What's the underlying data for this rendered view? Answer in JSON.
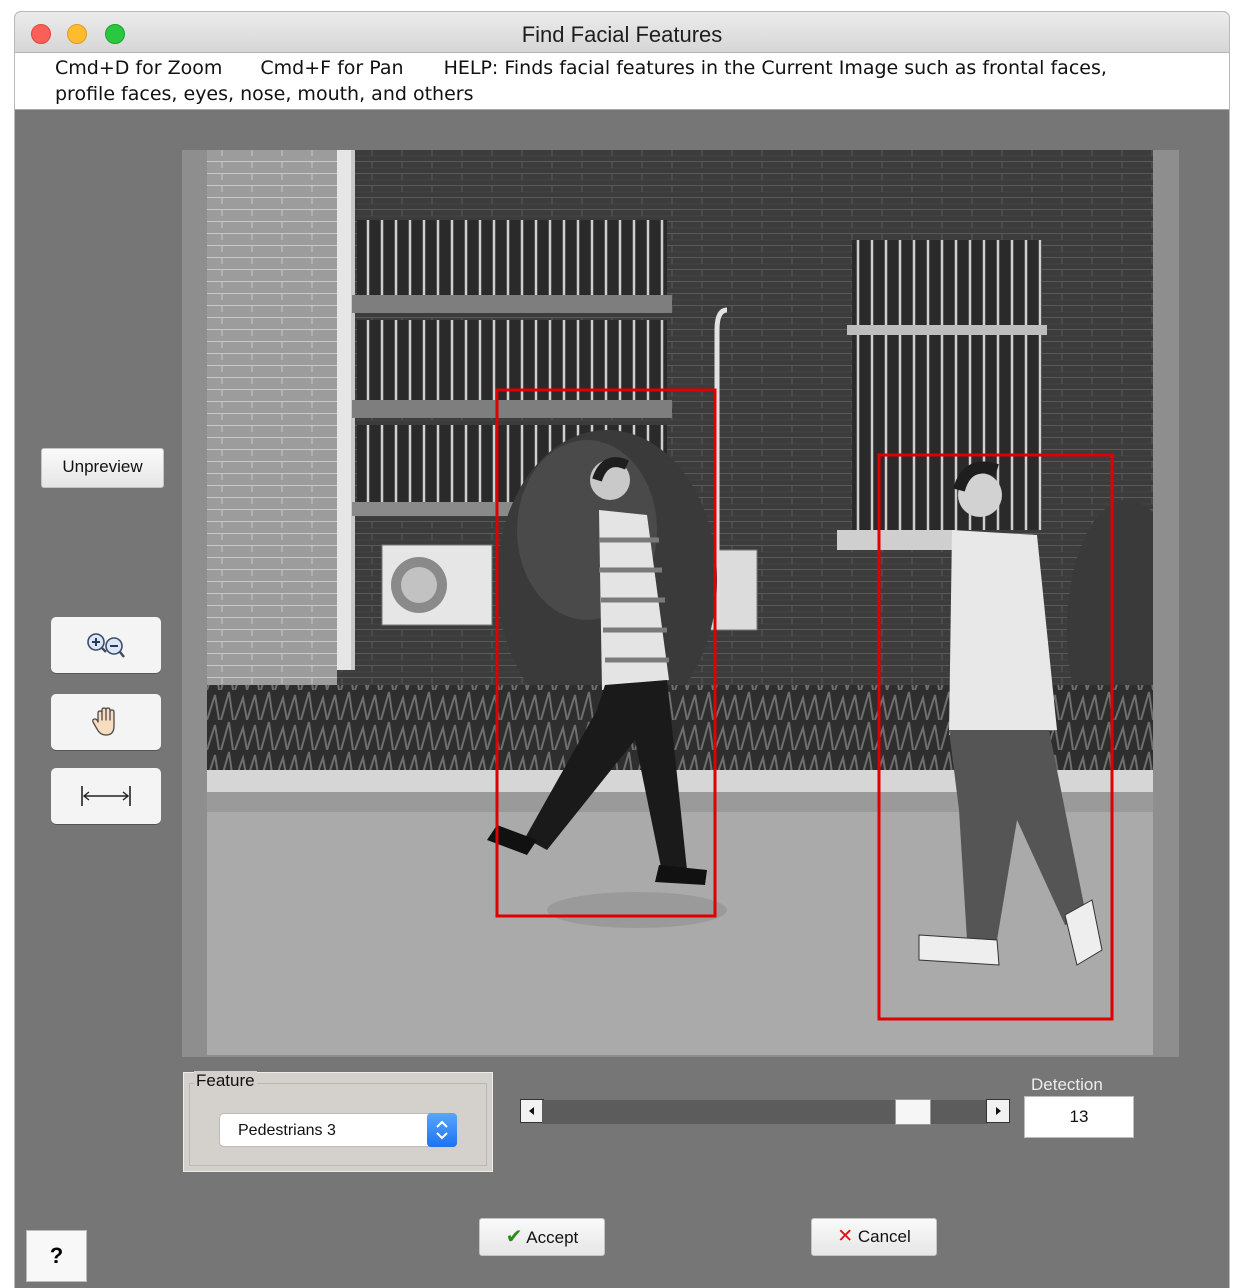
{
  "window": {
    "title": "Find Facial Features"
  },
  "help_text": {
    "zoom_shortcut": "Cmd+D for Zoom",
    "pan_shortcut": "Cmd+F for Pan",
    "help_line1": "HELP:  Finds facial features in the Current Image such as frontal faces,",
    "help_line2": "profile faces, eyes, nose, mouth, and others"
  },
  "sidebar": {
    "unpreview_label": "Unpreview",
    "tools": [
      {
        "icon": "zoom-in-out-icon"
      },
      {
        "icon": "hand-pan-icon"
      },
      {
        "icon": "fit-width-icon"
      }
    ]
  },
  "image": {
    "detections": 2
  },
  "feature": {
    "legend": "Feature",
    "selected": "Pedestrians 3"
  },
  "detection": {
    "label": "Detection",
    "value": "13",
    "slider_fraction": 0.86
  },
  "footer": {
    "accept_label": "Accept",
    "cancel_label": "Cancel",
    "help_label": "?"
  },
  "colors": {
    "window_bg": "#767676",
    "detection_box": "#e00000",
    "accept_check": "#2f8a1c",
    "cancel_x": "#e01010",
    "select_arrow": "#1d73f0"
  }
}
